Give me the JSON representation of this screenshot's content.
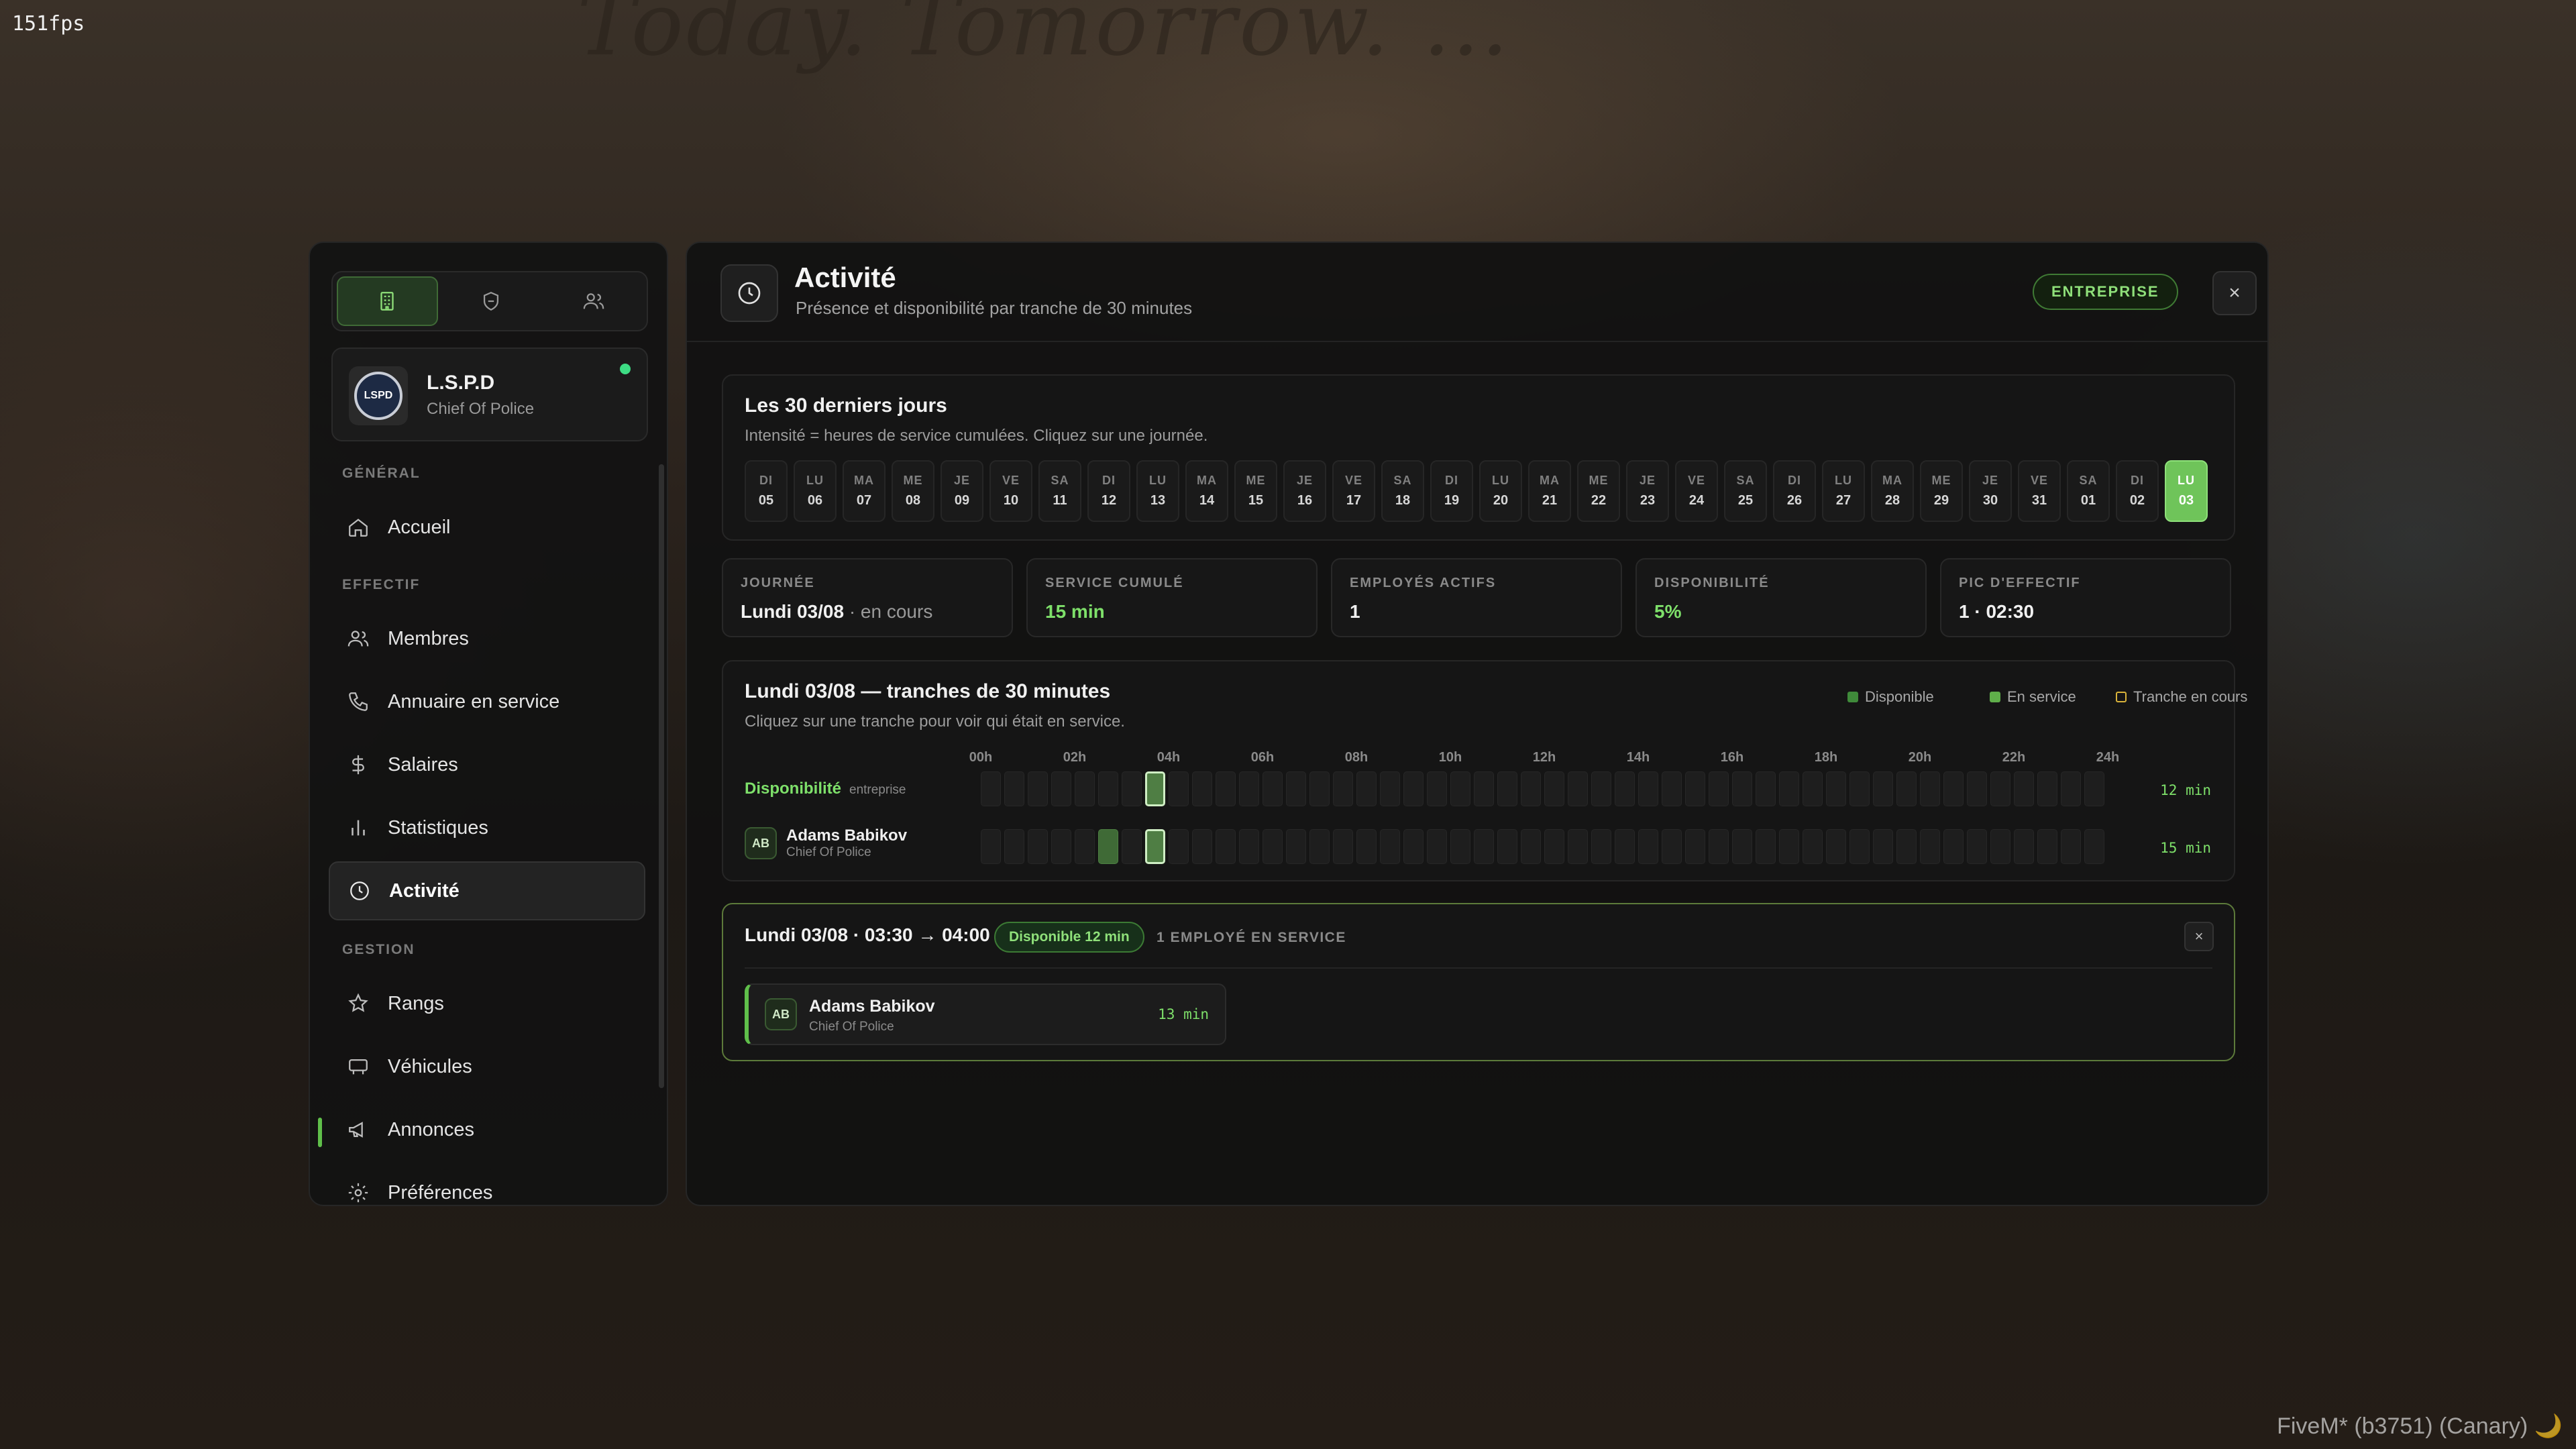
{
  "overlay": {
    "fps": "151fps",
    "client_build": "FiveM* (b3751) (Canary) 🌙",
    "background_banner": "Today. Tomorrow. …"
  },
  "sidebar": {
    "tabs": [
      {
        "icon": "building-icon",
        "active": true
      },
      {
        "icon": "shield-icon",
        "active": false
      },
      {
        "icon": "users-icon",
        "active": false
      }
    ],
    "org": {
      "name": "L.S.P.D",
      "role": "Chief Of Police",
      "logo_text": "LSPD",
      "online": true
    },
    "sections": [
      {
        "label": "GÉNÉRAL",
        "items": [
          {
            "label": "Accueil",
            "icon": "home-icon"
          }
        ]
      },
      {
        "label": "EFFECTIF",
        "items": [
          {
            "label": "Membres",
            "icon": "users-icon"
          },
          {
            "label": "Annuaire en service",
            "icon": "phone-icon"
          },
          {
            "label": "Salaires",
            "icon": "dollar-icon"
          },
          {
            "label": "Statistiques",
            "icon": "bar-chart-icon"
          },
          {
            "label": "Activité",
            "icon": "clock-icon",
            "active": true
          }
        ]
      },
      {
        "label": "GESTION",
        "items": [
          {
            "label": "Rangs",
            "icon": "star-icon"
          },
          {
            "label": "Véhicules",
            "icon": "vehicle-icon"
          },
          {
            "label": "Annonces",
            "icon": "megaphone-icon"
          },
          {
            "label": "Préférences",
            "icon": "gear-icon"
          }
        ]
      }
    ]
  },
  "header": {
    "title": "Activité",
    "subtitle": "Présence et disponibilité par tranche de 30 minutes",
    "badge": "ENTREPRISE",
    "close_label": "×"
  },
  "last30": {
    "title": "Les 30 derniers jours",
    "subtitle": "Intensité = heures de service cumulées. Cliquez sur une journée.",
    "days": [
      {
        "dn": "DI",
        "dd": "05"
      },
      {
        "dn": "LU",
        "dd": "06"
      },
      {
        "dn": "MA",
        "dd": "07"
      },
      {
        "dn": "ME",
        "dd": "08"
      },
      {
        "dn": "JE",
        "dd": "09"
      },
      {
        "dn": "VE",
        "dd": "10"
      },
      {
        "dn": "SA",
        "dd": "11"
      },
      {
        "dn": "DI",
        "dd": "12"
      },
      {
        "dn": "LU",
        "dd": "13"
      },
      {
        "dn": "MA",
        "dd": "14"
      },
      {
        "dn": "ME",
        "dd": "15"
      },
      {
        "dn": "JE",
        "dd": "16"
      },
      {
        "dn": "VE",
        "dd": "17"
      },
      {
        "dn": "SA",
        "dd": "18"
      },
      {
        "dn": "DI",
        "dd": "19"
      },
      {
        "dn": "LU",
        "dd": "20"
      },
      {
        "dn": "MA",
        "dd": "21"
      },
      {
        "dn": "ME",
        "dd": "22"
      },
      {
        "dn": "JE",
        "dd": "23"
      },
      {
        "dn": "VE",
        "dd": "24"
      },
      {
        "dn": "SA",
        "dd": "25"
      },
      {
        "dn": "DI",
        "dd": "26"
      },
      {
        "dn": "LU",
        "dd": "27"
      },
      {
        "dn": "MA",
        "dd": "28"
      },
      {
        "dn": "ME",
        "dd": "29"
      },
      {
        "dn": "JE",
        "dd": "30"
      },
      {
        "dn": "VE",
        "dd": "31"
      },
      {
        "dn": "SA",
        "dd": "01"
      },
      {
        "dn": "DI",
        "dd": "02"
      },
      {
        "dn": "LU",
        "dd": "03",
        "selected": true
      }
    ]
  },
  "stats": [
    {
      "label": "JOURNÉE",
      "value": "Lundi 03/08",
      "suffix": " · en cours",
      "green": false
    },
    {
      "label": "SERVICE CUMULÉ",
      "value": "15 min",
      "suffix": "",
      "green": true
    },
    {
      "label": "EMPLOYÉS ACTIFS",
      "value": "1",
      "suffix": "",
      "green": false
    },
    {
      "label": "DISPONIBILITÉ",
      "value": "5%",
      "suffix": "",
      "green": true
    },
    {
      "label": "PIC D'EFFECTIF",
      "value": "1 · 02:30",
      "suffix": "",
      "green": false
    }
  ],
  "timeline": {
    "title": "Lundi 03/08 — tranches de 30 minutes",
    "subtitle": "Cliquez sur une tranche pour voir qui était en service.",
    "legend": [
      {
        "label": "Disponible",
        "color": "#3f8a3a"
      },
      {
        "label": "En service",
        "color": "#5fae4a"
      },
      {
        "label": "Tranche en cours",
        "color": "#d8b23a"
      }
    ],
    "hours": [
      "00h",
      "02h",
      "04h",
      "06h",
      "08h",
      "10h",
      "12h",
      "14h",
      "16h",
      "18h",
      "20h",
      "22h",
      "24h"
    ],
    "slot_count": 48,
    "current_slot": 7,
    "rows": [
      {
        "label": "Disponibilité",
        "tag": "entreprise",
        "total": "12 min",
        "on_slots": [
          7
        ]
      },
      {
        "name": "Adams Babikov",
        "role": "Chief Of Police",
        "initials": "AB",
        "total": "15 min",
        "on_slots": [
          5,
          7
        ]
      }
    ]
  },
  "detail": {
    "title": "Lundi 03/08 · 03:30 → 04:00",
    "pill": "Disponible 12 min",
    "count": "1 EMPLOYÉ EN SERVICE",
    "close_label": "×",
    "employees": [
      {
        "name": "Adams Babikov",
        "role": "Chief Of Police",
        "initials": "AB",
        "duration": "13 min"
      }
    ]
  }
}
